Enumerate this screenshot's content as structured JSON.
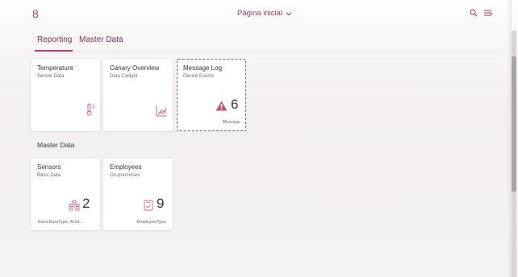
{
  "shell": {
    "logo": "8",
    "home_title": "Página inicial",
    "icons": {
      "search": "search-icon",
      "menu": "notifications-menu-icon",
      "title_chevron": "chevron-down-icon"
    }
  },
  "tabs": [
    {
      "label": "Reporting",
      "selected": true
    },
    {
      "label": "Master Data",
      "selected": false
    }
  ],
  "groups": [
    {
      "title": "",
      "tiles": [
        {
          "title": "Temperature",
          "subtitle": "Sensor Data",
          "icon": "thermometer-icon"
        },
        {
          "title": "Canary Overview",
          "subtitle": "Data Cockpit",
          "icon": "line-chart-icon"
        },
        {
          "title": "Message Log",
          "subtitle": "Device Events",
          "icon": "alert-icon",
          "number": "6",
          "footer": "Message"
        }
      ]
    },
    {
      "title": "Master Data",
      "tiles": [
        {
          "title": "Sensors",
          "subtitle": "Basic Data",
          "icon": "network-icon",
          "number": "2",
          "footer": "BasicDataType, Activ..."
        },
        {
          "title": "Employees",
          "subtitle": "On-premisses",
          "icon": "document-check-icon",
          "number": "9",
          "footer": "EmployeeType"
        }
      ]
    }
  ],
  "colors": {
    "accent": "#b0446e",
    "alert": "#c0527e",
    "icon": "#c86a94",
    "text": "#32363a",
    "subtext": "#6a6d70"
  }
}
